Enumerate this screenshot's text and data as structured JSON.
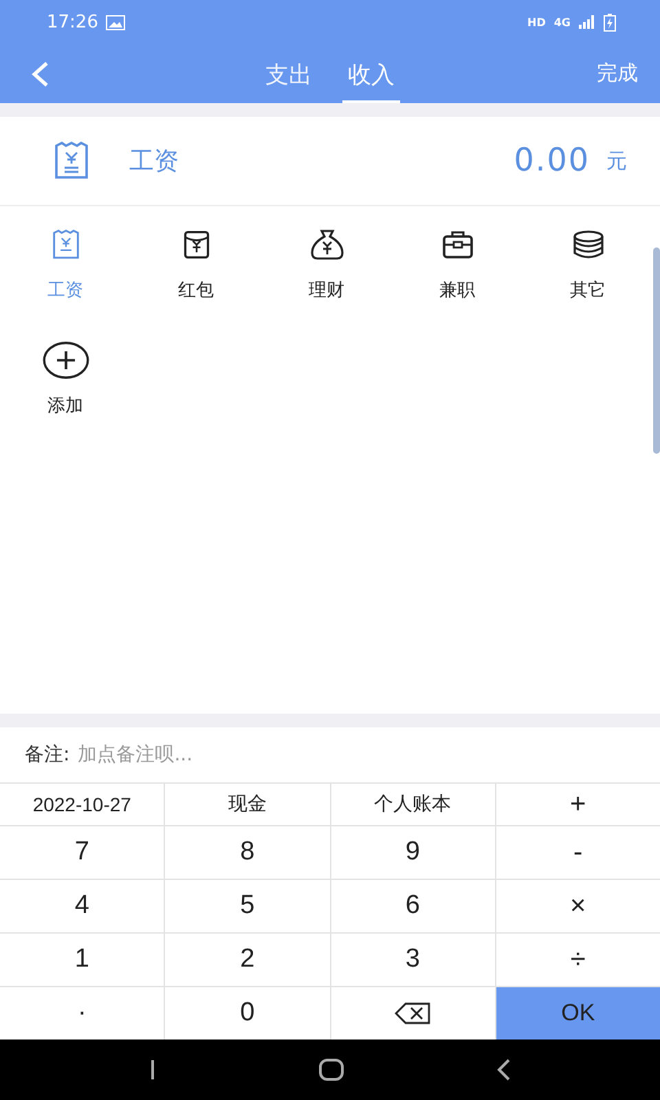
{
  "status_bar": {
    "time": "17:26",
    "network": "HD",
    "signal_label": "4G"
  },
  "header": {
    "tabs": [
      {
        "label": "支出",
        "selected": false
      },
      {
        "label": "收入",
        "selected": true
      }
    ],
    "done": "完成"
  },
  "amount_row": {
    "category": "工资",
    "amount": "0.00",
    "unit": "元"
  },
  "categories": [
    {
      "kind": "salary",
      "label": "工资",
      "selected": true
    },
    {
      "kind": "envelope",
      "label": "红包",
      "selected": false
    },
    {
      "kind": "moneybag",
      "label": "理财",
      "selected": false
    },
    {
      "kind": "briefcase",
      "label": "兼职",
      "selected": false
    },
    {
      "kind": "coins",
      "label": "其它",
      "selected": false
    },
    {
      "kind": "add",
      "label": "添加",
      "selected": false
    }
  ],
  "note": {
    "label": "备注:",
    "placeholder": "加点备注呗..."
  },
  "keypad": [
    {
      "kind": "text",
      "label": "2022-10-27"
    },
    {
      "kind": "text",
      "label": "现金"
    },
    {
      "kind": "text",
      "label": "个人账本"
    },
    {
      "kind": "op",
      "label": "+"
    },
    {
      "kind": "digit",
      "label": "7"
    },
    {
      "kind": "digit",
      "label": "8"
    },
    {
      "kind": "digit",
      "label": "9"
    },
    {
      "kind": "op",
      "label": "-"
    },
    {
      "kind": "digit",
      "label": "4"
    },
    {
      "kind": "digit",
      "label": "5"
    },
    {
      "kind": "digit",
      "label": "6"
    },
    {
      "kind": "op",
      "label": "×"
    },
    {
      "kind": "digit",
      "label": "1"
    },
    {
      "kind": "digit",
      "label": "2"
    },
    {
      "kind": "digit",
      "label": "3"
    },
    {
      "kind": "op",
      "label": "÷"
    },
    {
      "kind": "digit",
      "label": "·"
    },
    {
      "kind": "digit",
      "label": "0"
    },
    {
      "kind": "backspace"
    },
    {
      "kind": "ok",
      "label": "OK"
    }
  ]
}
